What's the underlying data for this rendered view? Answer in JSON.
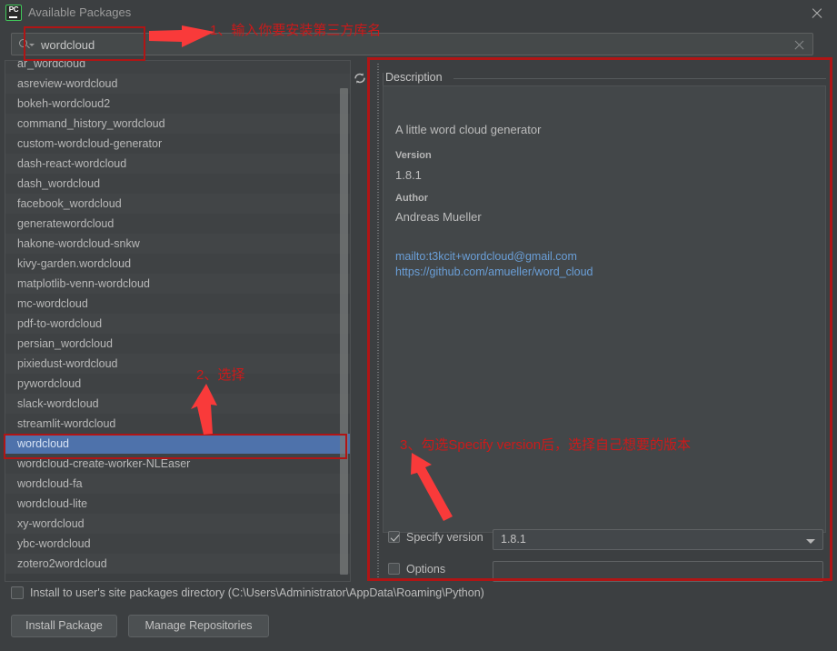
{
  "window": {
    "title": "Available Packages",
    "app_icon": "pycharm-pc-icon",
    "close_icon": "close-icon"
  },
  "search": {
    "value": "wordcloud",
    "placeholder": "",
    "icon": "search-icon",
    "clear_icon": "clear-icon"
  },
  "toolbar": {
    "refresh_icon": "refresh-icon"
  },
  "packages": {
    "selected": "wordcloud",
    "items": [
      "ar_wordcloud",
      "asreview-wordcloud",
      "bokeh-wordcloud2",
      "command_history_wordcloud",
      "custom-wordcloud-generator",
      "dash-react-wordcloud",
      "dash_wordcloud",
      "facebook_wordcloud",
      "generatewordcloud",
      "hakone-wordcloud-snkw",
      "kivy-garden.wordcloud",
      "matplotlib-venn-wordcloud",
      "mc-wordcloud",
      "pdf-to-wordcloud",
      "persian_wordcloud",
      "pixiedust-wordcloud",
      "pywordcloud",
      "slack-wordcloud",
      "streamlit-wordcloud",
      "wordcloud",
      "wordcloud-create-worker-NLEaser",
      "wordcloud-fa",
      "wordcloud-lite",
      "xy-wordcloud",
      "ybc-wordcloud",
      "zotero2wordcloud"
    ]
  },
  "description": {
    "legend": "Description",
    "summary": "A little word cloud generator",
    "version_label": "Version",
    "version_value": "1.8.1",
    "author_label": "Author",
    "author_value": "Andreas Mueller",
    "links": [
      "mailto:t3kcit+wordcloud@gmail.com",
      "https://github.com/amueller/word_cloud"
    ]
  },
  "options": {
    "specify_version_label": "Specify version",
    "specify_version_checked": true,
    "specify_version_value": "1.8.1",
    "options_label": "Options",
    "options_checked": false,
    "options_value": "",
    "dropdown_icon": "chevron-down-icon"
  },
  "footer": {
    "user_site_label": "Install to user's site packages directory (C:\\Users\\Administrator\\AppData\\Roaming\\Python)",
    "user_site_checked": false,
    "install_button": "Install Package",
    "manage_button": "Manage Repositories"
  },
  "annotations": {
    "step1": "1、输入你要安装第三方库名",
    "step2": "2、选择",
    "step3": "3、勾选Specify version后，选择自己想要的版本",
    "color": "#cc1a1a"
  }
}
